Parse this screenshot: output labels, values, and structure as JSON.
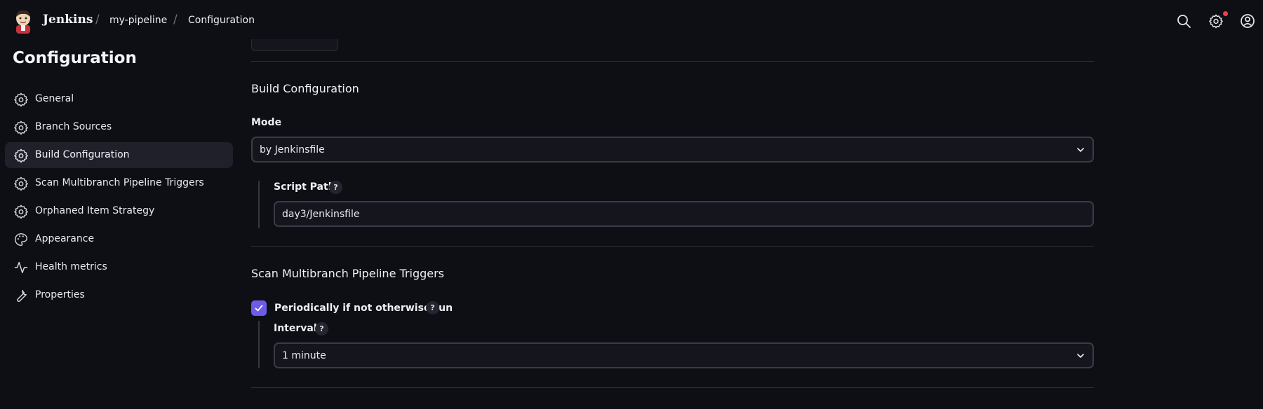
{
  "header": {
    "brand": "Jenkins",
    "breadcrumbs": [
      "my-pipeline",
      "Configuration"
    ],
    "separator": "/",
    "icons": [
      "search-icon",
      "gear-icon",
      "user-icon"
    ],
    "notification_color": "#ff3b4a"
  },
  "sidebar": {
    "title": "Configuration",
    "items": [
      {
        "label": "General",
        "icon": "gear-icon"
      },
      {
        "label": "Branch Sources",
        "icon": "gear-icon"
      },
      {
        "label": "Build Configuration",
        "icon": "gear-icon",
        "active": true
      },
      {
        "label": "Scan Multibranch Pipeline Triggers",
        "icon": "gear-icon"
      },
      {
        "label": "Orphaned Item Strategy",
        "icon": "gear-icon"
      },
      {
        "label": "Appearance",
        "icon": "palette-icon"
      },
      {
        "label": "Health metrics",
        "icon": "pulse-icon"
      },
      {
        "label": "Properties",
        "icon": "wrench-icon"
      }
    ]
  },
  "main": {
    "build": {
      "title": "Build Configuration",
      "mode_label": "Mode",
      "mode_value": "by Jenkinsfile",
      "script_path_label": "Script Path",
      "script_path_value": "day3/Jenkinsfile",
      "help": "?"
    },
    "triggers": {
      "title": "Scan Multibranch Pipeline Triggers",
      "periodic_label": "Periodically if not otherwise run",
      "periodic_checked": true,
      "interval_label": "Interval",
      "interval_value": "1 minute",
      "help": "?"
    }
  },
  "colors": {
    "background": "#0e0f15",
    "accent": "#6c5ce7",
    "active_item": "#1f2029"
  }
}
